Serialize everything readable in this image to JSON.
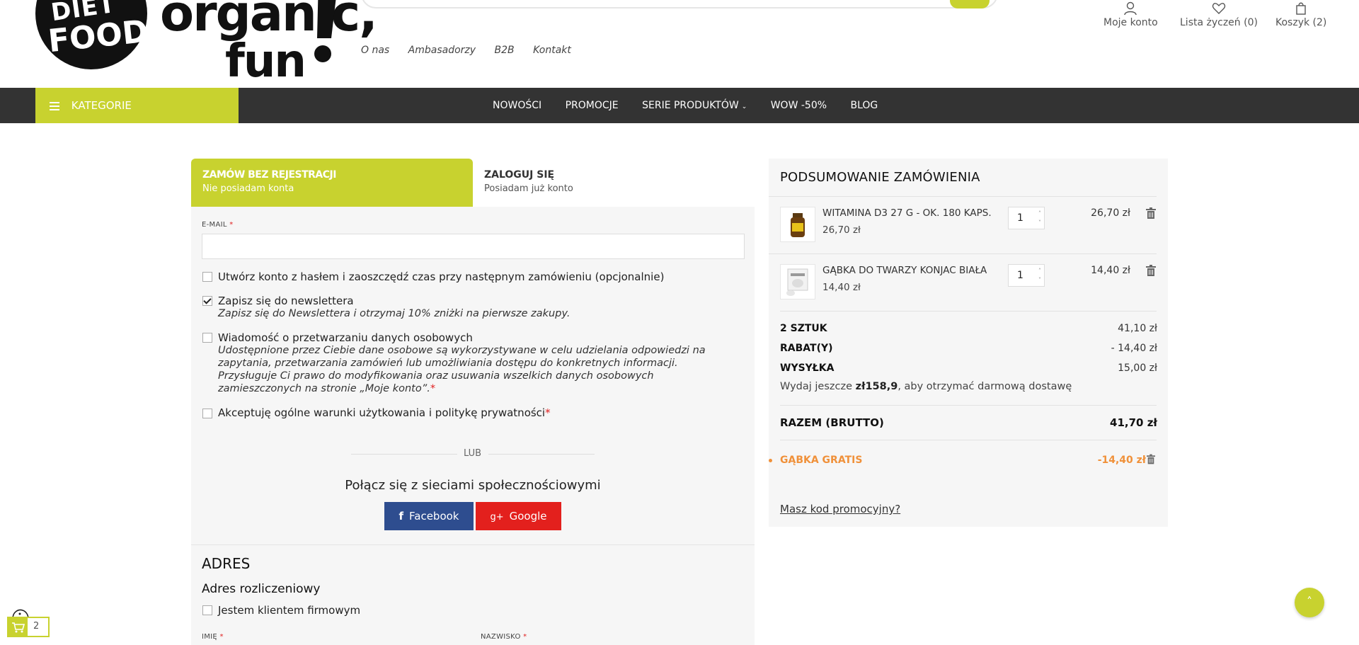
{
  "brand": {
    "logo_circle_line1": "DIET",
    "logo_circle_line2": "FOOD",
    "logo_word1": "organic,",
    "logo_word2": "fun",
    "accent": "#c8d22f",
    "dark_nav": "#333333",
    "promo_color": "#f0913a"
  },
  "top_links": [
    "O nas",
    "Ambasadorzy",
    "B2B",
    "Kontakt"
  ],
  "header_actions": {
    "account": {
      "label": "Moje konto",
      "icon": "user-icon"
    },
    "wishlist": {
      "label": "Lista życzeń (0)",
      "icon": "heart-icon"
    },
    "cart": {
      "label": "Koszyk (2)",
      "icon": "bag-icon"
    }
  },
  "nav": {
    "categories_label": "KATEGORIE",
    "items": [
      "NOWOŚCI",
      "PROMOCJE",
      "SERIE PRODUKTÓW",
      "WOW -50%",
      "BLOG"
    ]
  },
  "tabs": {
    "guest": {
      "title": "ZAMÓW BEZ REJESTRACJI",
      "subtitle": "Nie posiadam konta"
    },
    "login": {
      "title": "ZALOGUJ SIĘ",
      "subtitle": "Posiadam już konto"
    }
  },
  "form": {
    "email_label": "E-MAIL",
    "email_value": "",
    "create_account": "Utwórz konto z hasłem i zaoszczędź czas przy następnym zamówieniu (opcjonalnie)",
    "newsletter": "Zapisz się do newslettera",
    "newsletter_sub": "Zapisz się do Newslettera i otrzymaj 10% zniżki na pierwsze zakupy.",
    "privacy": "Wiadomość o przetwarzaniu danych osobowych",
    "privacy_sub_1": "Udostępnione przez Ciebie dane osobowe są wykorzystywane w celu udzielania odpowiedzi na",
    "privacy_sub_2": "zapytania, przetwarzania zamówień lub umożliwiania dostępu do konkretnych informacji.",
    "privacy_sub_3": "Przysługuje Ci prawo do modyfikowania oraz usuwania wszelkich danych osobowych",
    "privacy_sub_4": "zamieszczonych na stronie „Moje konto”.",
    "terms": "Akceptuję ogólne warunki użytkowania i politykę prywatności",
    "or": "LUB",
    "social_title": "Połącz się z sieciami społecznościowymi",
    "facebook": "Facebook",
    "google": "Google",
    "address_heading": "ADRES",
    "billing_heading": "Adres rozliczeniowy",
    "company_client": "Jestem klientem firmowym",
    "first_name_label": "IMIĘ",
    "last_name_label": "NAZWISKO"
  },
  "summary": {
    "title": "PODSUMOWANIE ZAMÓWIENIA",
    "products": [
      {
        "name": "WITAMINA D3 27 G - OK. 180 KAPS.",
        "unit_price": "26,70 zł",
        "qty": "1",
        "total": "26,70 zł"
      },
      {
        "name": "GĄBKA DO TWARZY KONJAC BIAŁA",
        "unit_price": "14,40 zł",
        "qty": "1",
        "total": "14,40 zł"
      }
    ],
    "items_label": "2 SZTUK",
    "items_value": "41,10 zł",
    "discount_label": "RABAT(Y)",
    "discount_value": "- 14,40 zł",
    "shipping_label": "WYSYŁKA",
    "shipping_value": "15,00 zł",
    "free_ship_pre": "Wydaj jeszcze ",
    "free_ship_amount": "zł158,9",
    "free_ship_post": ", aby otrzymać darmową dostawę",
    "total_label": "RAZEM (BRUTTO)",
    "total_value": "41,70 zł",
    "promo_label": "GĄBKA GRATIS",
    "promo_value": "-14,40 zł",
    "promo_code_link": "Masz kod promocyjny?"
  },
  "floating": {
    "mini_cart_count": "2"
  }
}
